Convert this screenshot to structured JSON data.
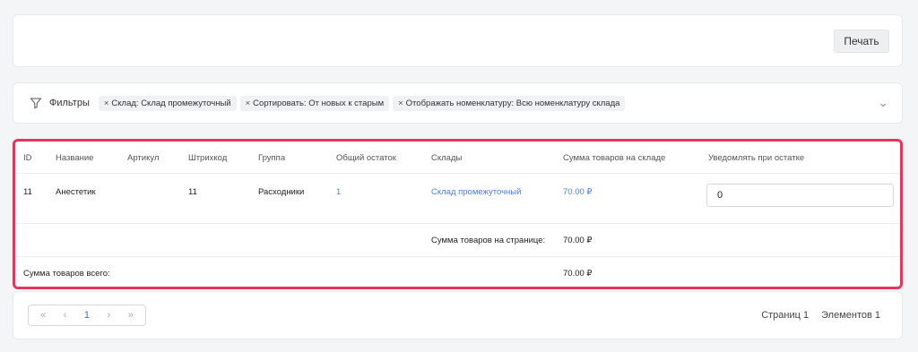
{
  "toolbar": {
    "print_label": "Печать"
  },
  "filters": {
    "label": "Фильтры",
    "chips": [
      "Склад: Склад промежуточный",
      "Сортировать: От новых к старым",
      "Отображать номенклатуру: Всю номенклатуру склада"
    ],
    "chip_remove": "×"
  },
  "table": {
    "columns": [
      "ID",
      "Название",
      "Артикул",
      "Штрихкод",
      "Группа",
      "Общий остаток",
      "Склады",
      "Сумма товаров на складе",
      "Уведомлять при остатке"
    ],
    "rows": [
      {
        "id": "11",
        "name": "Анестетик",
        "article": "",
        "barcode": "11",
        "group": "Расходники",
        "total": "1",
        "warehouses": "Склад промежуточный",
        "sum": "70.00 ₽",
        "notify": "0"
      }
    ],
    "page_sum_label": "Сумма товаров на странице:",
    "page_sum_value": "70.00 ₽",
    "total_sum_label": "Сумма товаров всего:",
    "total_sum_value": "70.00 ₽"
  },
  "pagination": {
    "first": "«",
    "prev": "‹",
    "current": "1",
    "next": "›",
    "last": "»",
    "pages_text": "Страниц 1",
    "elements_text": "Элементов 1"
  },
  "colors": {
    "highlight_border": "#e8355b",
    "link": "#4a7fd6"
  }
}
